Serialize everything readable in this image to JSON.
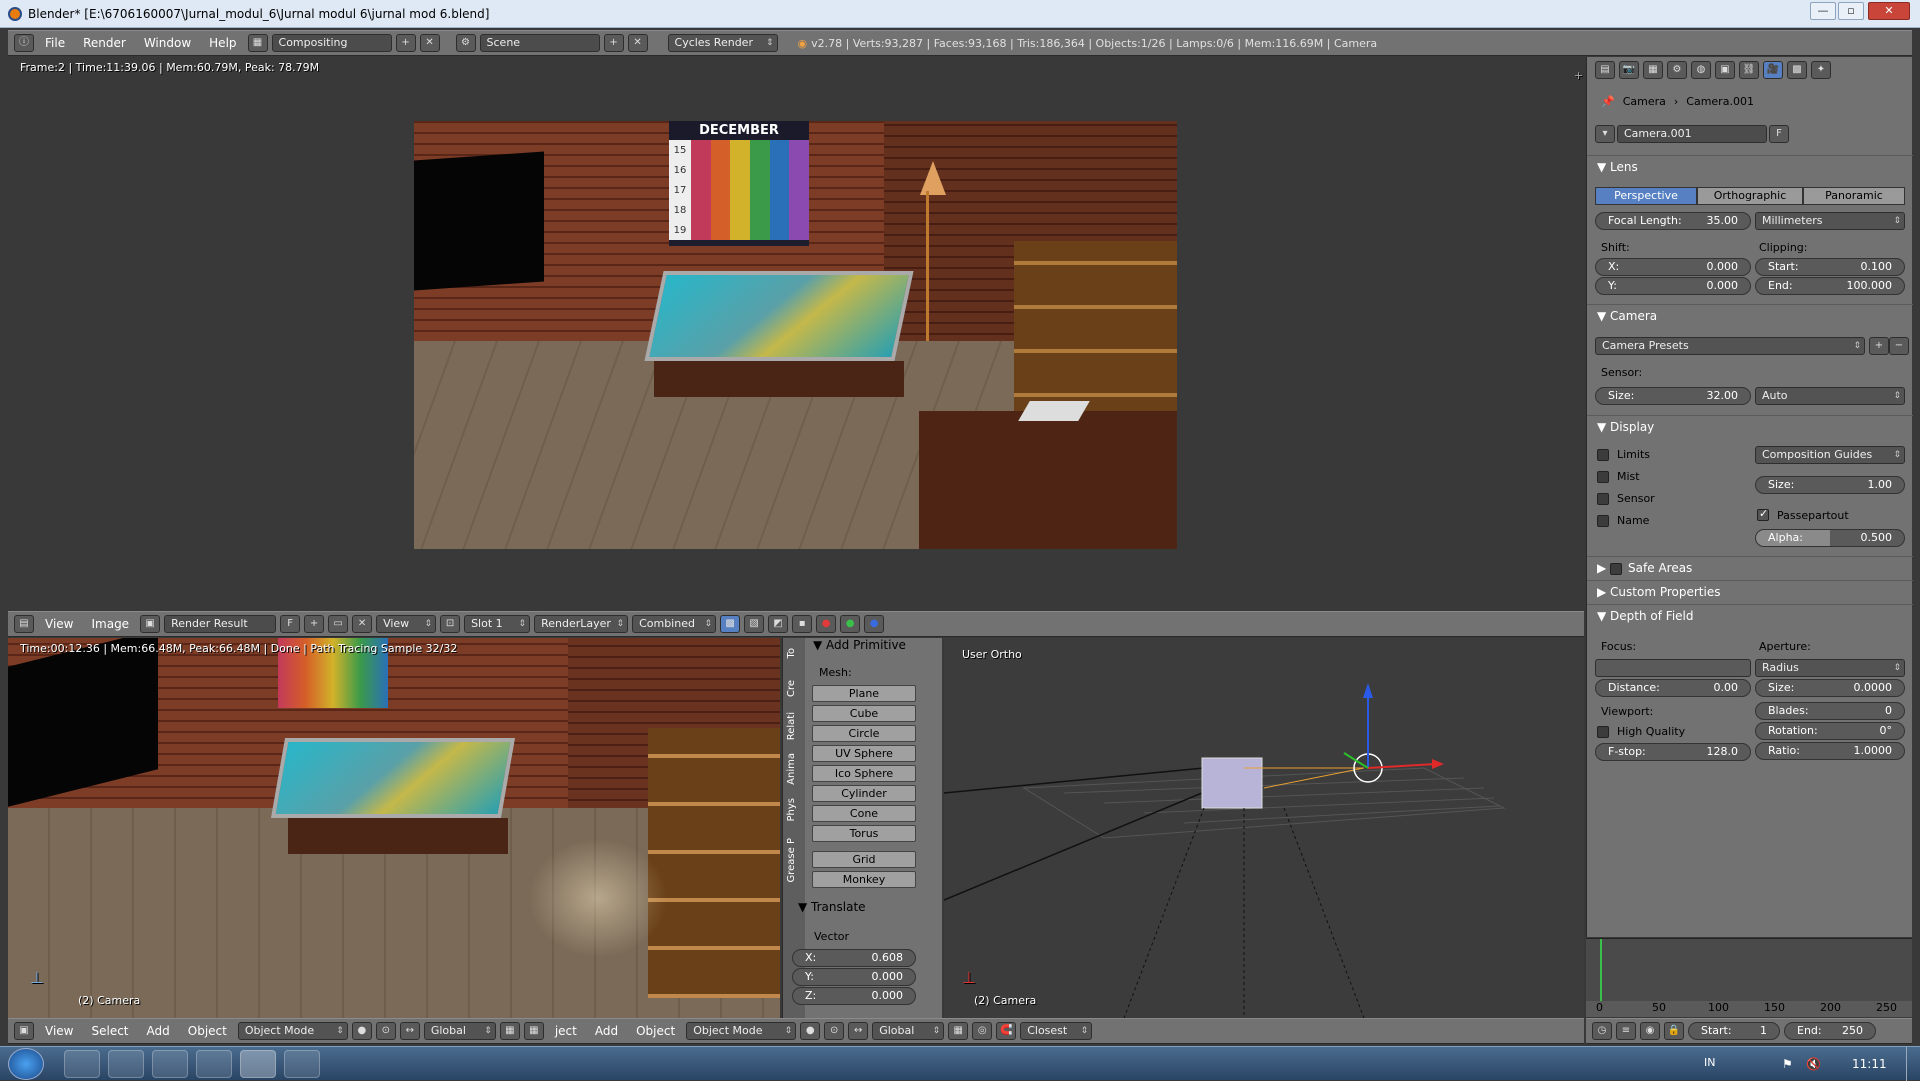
{
  "window": {
    "title": "Blender* [E:\\6706160007\\Jurnal_modul_6\\Jurnal modul 6\\jurnal mod 6.blend]",
    "minimize": "—",
    "maximize": "▫",
    "close": "✕"
  },
  "top_header": {
    "menus": [
      "File",
      "Render",
      "Window",
      "Help"
    ],
    "layout": "Compositing",
    "scene": "Scene",
    "engine": "Cycles Render",
    "stats": "v2.78 | Verts:93,287 | Faces:93,168 | Tris:186,364 | Objects:1/26 | Lamps:0/6 | Mem:116.69M | Camera"
  },
  "top_view": {
    "info": "Frame:2 | Time:11:39.06 | Mem:60.79M, Peak: 78.79M"
  },
  "image_header": {
    "menus": [
      "View",
      "Image"
    ],
    "image": "Render Result",
    "fake_user": "F",
    "view": "View",
    "slot": "Slot 1",
    "layer": "RenderLayer",
    "pass": "Combined"
  },
  "bottom_left_view": {
    "info": "Time:00:12.36 | Mem:66.48M, Peak:66.48M | Done | Path Tracing Sample 32/32",
    "camera": "(2) Camera"
  },
  "tool_shelf": {
    "section": "Add Primitive",
    "mesh_label": "Mesh:",
    "tabs": [
      "To",
      "Cre",
      "Relati",
      "Anima",
      "Phys",
      "Grease P"
    ],
    "buttons": [
      "Plane",
      "Cube",
      "Circle",
      "UV Sphere",
      "Ico Sphere",
      "Cylinder",
      "Cone",
      "Torus"
    ],
    "extra": [
      "Grid",
      "Monkey"
    ],
    "translate": {
      "title": "Translate",
      "vector_label": "Vector",
      "x_label": "X:",
      "x": "0.608",
      "y_label": "Y:",
      "y": "0.000",
      "z_label": "Z:",
      "z": "0.000"
    }
  },
  "view3d": {
    "label": "User Ortho",
    "camera": "(2) Camera"
  },
  "bottom_header": {
    "menus_left": [
      "View",
      "Select",
      "Add",
      "Object"
    ],
    "mode": "Object Mode",
    "orientation": "Global",
    "menus_mid": [
      "ject",
      "Add",
      "Object"
    ],
    "mode2": "Object Mode",
    "orientation2": "Global",
    "snap": "Closest"
  },
  "properties": {
    "breadcrumb": [
      "Camera",
      "Camera.001"
    ],
    "datablock": "Camera.001",
    "fake_user": "F",
    "lens": {
      "title": "Lens",
      "types": [
        "Perspective",
        "Orthographic",
        "Panoramic"
      ],
      "active": "Perspective",
      "focal_label": "Focal Length:",
      "focal": "35.00",
      "units": "Millimeters",
      "shift_label": "Shift:",
      "clip_label": "Clipping:",
      "shift_x_label": "X:",
      "shift_x": "0.000",
      "shift_y_label": "Y:",
      "shift_y": "0.000",
      "clip_start_label": "Start:",
      "clip_start": "0.100",
      "clip_end_label": "End:",
      "clip_end": "100.000"
    },
    "camera": {
      "title": "Camera",
      "presets": "Camera Presets",
      "sensor_label": "Sensor:",
      "size_label": "Size:",
      "size": "32.00",
      "fit": "Auto"
    },
    "display": {
      "title": "Display",
      "checks": [
        "Limits",
        "Mist",
        "Sensor",
        "Name"
      ],
      "guides": "Composition Guides",
      "size_label": "Size:",
      "size": "1.00",
      "passepartout": "Passepartout",
      "alpha_label": "Alpha:",
      "alpha": "0.500"
    },
    "safe_areas": "Safe Areas",
    "custom_props": "Custom Properties",
    "dof": {
      "title": "Depth of Field",
      "focus_label": "Focus:",
      "aperture_label": "Aperture:",
      "aperture_type": "Radius",
      "distance_label": "Distance:",
      "distance": "0.00",
      "size_label": "Size:",
      "size": "0.0000",
      "viewport_label": "Viewport:",
      "blades_label": "Blades:",
      "blades": "0",
      "high_quality": "High Quality",
      "rotation_label": "Rotation:",
      "rotation": "0°",
      "fstop_label": "F-stop:",
      "fstop": "128.0",
      "ratio_label": "Ratio:",
      "ratio": "1.0000"
    }
  },
  "timeline": {
    "ticks": [
      "0",
      "50",
      "100",
      "150",
      "200",
      "250"
    ],
    "start_label": "Start:",
    "start": "1",
    "end_label": "End:",
    "end": "250"
  },
  "taskbar": {
    "lang": "IN",
    "time": "11:11"
  },
  "calendar_label": "DECEMBER",
  "calendar_days": [
    "15",
    "16",
    "17",
    "18",
    "19"
  ]
}
